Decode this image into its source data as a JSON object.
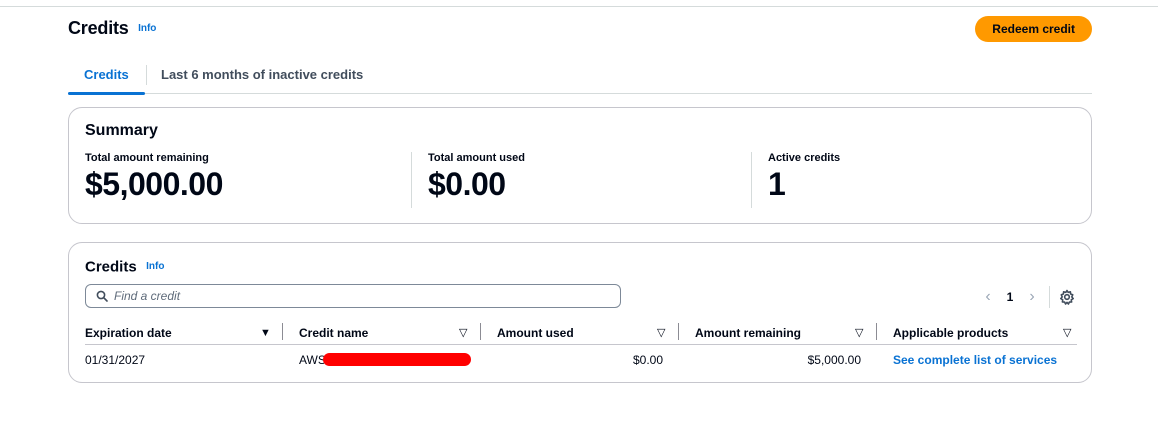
{
  "header": {
    "title": "Credits",
    "info": "Info",
    "redeem_label": "Redeem credit"
  },
  "tabs": [
    {
      "label": "Credits",
      "active": true
    },
    {
      "label": "Last 6 months of inactive credits",
      "active": false
    }
  ],
  "summary": {
    "title": "Summary",
    "metrics": [
      {
        "label": "Total amount remaining",
        "value": "$5,000.00"
      },
      {
        "label": "Total amount used",
        "value": "$0.00"
      },
      {
        "label": "Active credits",
        "value": "1"
      }
    ]
  },
  "credits_table": {
    "title": "Credits",
    "info": "Info",
    "search_placeholder": "Find a credit",
    "search_value": "",
    "pagination": {
      "current_page": "1",
      "prev_icon": "chevron-left-icon",
      "next_icon": "chevron-right-icon"
    },
    "settings_icon": "gear-icon",
    "columns": [
      {
        "label": "Expiration date",
        "sort_icon": "sorted-descending-icon"
      },
      {
        "label": "Credit name",
        "sort_icon": "sortable-icon"
      },
      {
        "label": "Amount used",
        "sort_icon": "sortable-icon"
      },
      {
        "label": "Amount remaining",
        "sort_icon": "sortable-icon"
      },
      {
        "label": "Applicable products",
        "sort_icon": "sortable-icon"
      }
    ],
    "rows": [
      {
        "expiration_date": "01/31/2027",
        "credit_name": "AWS",
        "amount_used": "$0.00",
        "amount_remaining": "$5,000.00",
        "applicable_products": "See complete list of services"
      }
    ]
  },
  "colors": {
    "accent": "#0972d3",
    "primary_button": "#ff9900",
    "text": "#000716",
    "border": "#c6c6cd",
    "redaction": "#ff0000"
  }
}
